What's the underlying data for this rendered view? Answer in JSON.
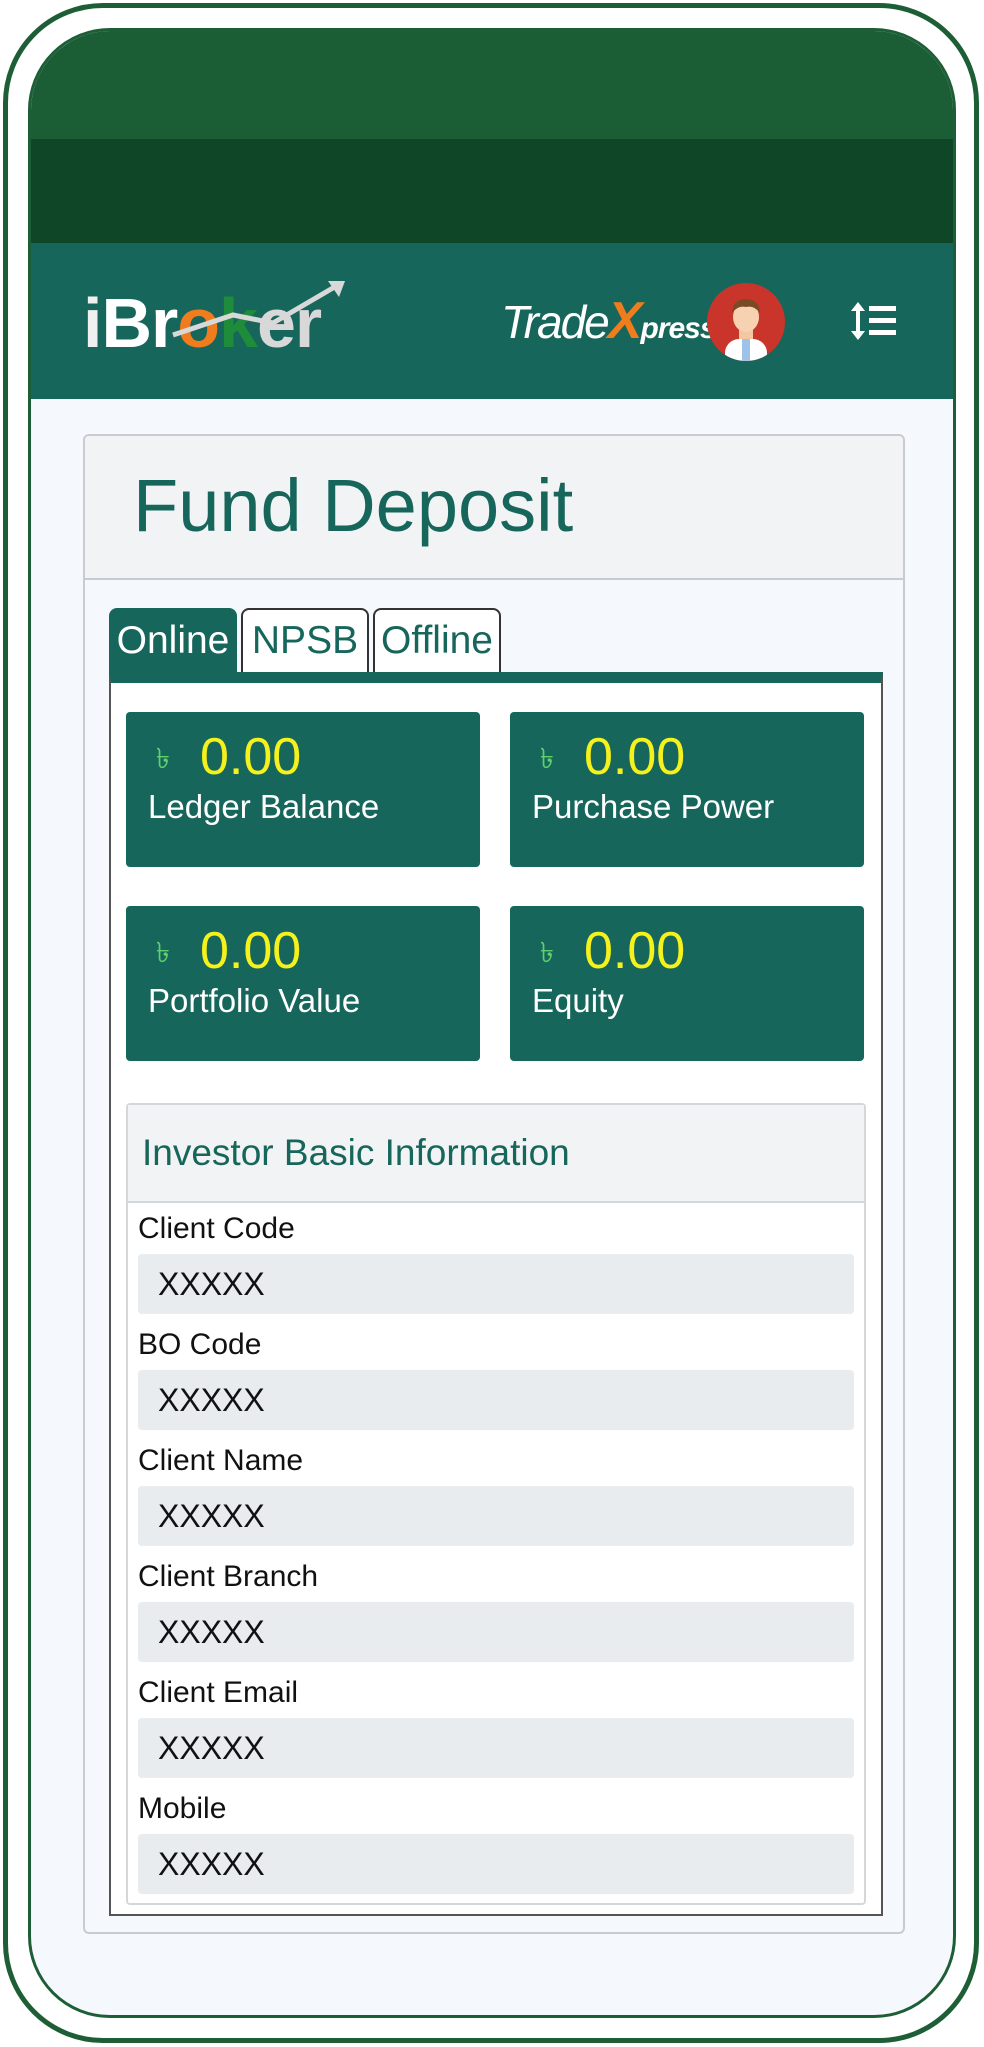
{
  "header": {
    "logo_left": "iBroker",
    "logo_left_parts": {
      "i": "i",
      "br": "Br",
      "o": "o",
      "k": "k",
      "er": "er"
    },
    "logo_right_trade": "Trade",
    "logo_right_x": "X",
    "logo_right_press": "press",
    "avatar_icon": "user-avatar-icon",
    "menu_icon": "sort-list-icon"
  },
  "page": {
    "title": "Fund Deposit"
  },
  "tabs": [
    {
      "label": "Online",
      "active": true
    },
    {
      "label": "NPSB",
      "active": false
    },
    {
      "label": "Offline",
      "active": false
    }
  ],
  "stats": [
    {
      "currency": "৳",
      "amount": "0.00",
      "label": "Ledger Balance"
    },
    {
      "currency": "৳",
      "amount": "0.00",
      "label": "Purchase Power"
    },
    {
      "currency": "৳",
      "amount": "0.00",
      "label": "Portfolio Value"
    },
    {
      "currency": "৳",
      "amount": "0.00",
      "label": "Equity"
    }
  ],
  "investor": {
    "title": "Investor Basic Information",
    "fields": [
      {
        "label": "Client Code",
        "value": "XXXXX"
      },
      {
        "label": "BO Code",
        "value": "XXXXX"
      },
      {
        "label": "Client Name",
        "value": "XXXXX"
      },
      {
        "label": "Client Branch",
        "value": "XXXXX"
      },
      {
        "label": "Client Email",
        "value": "XXXXX"
      },
      {
        "label": "Mobile",
        "value": "XXXXX"
      }
    ]
  },
  "colors": {
    "brand_green": "#17665b",
    "frame_green": "#1d5e37",
    "amount_yellow": "#f4f11c",
    "accent_orange": "#f07c1e"
  }
}
